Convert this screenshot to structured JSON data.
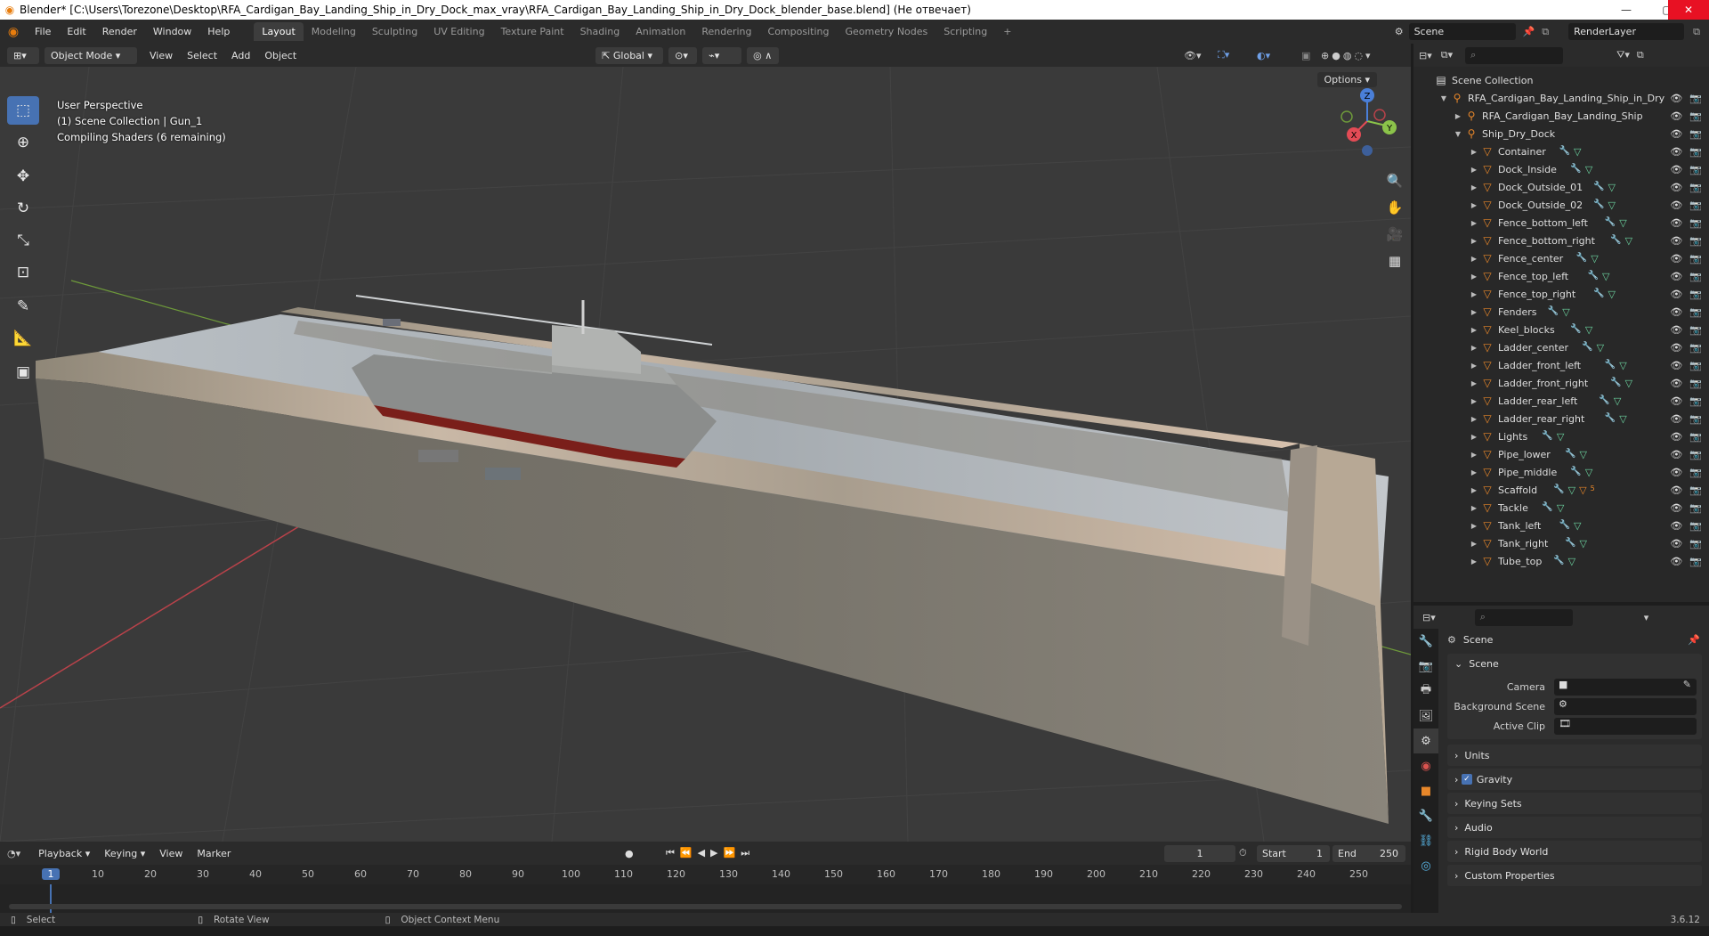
{
  "titlebar": {
    "title": "Blender* [C:\\Users\\Torezone\\Desktop\\RFA_Cardigan_Bay_Landing_Ship_in_Dry_Dock_max_vray\\RFA_Cardigan_Bay_Landing_Ship_in_Dry_Dock_blender_base.blend] (Не отвечает)",
    "minimize": "—",
    "maximize": "▢",
    "close": "✕"
  },
  "menus": [
    "File",
    "Edit",
    "Render",
    "Window",
    "Help"
  ],
  "workspaces": [
    "Layout",
    "Modeling",
    "Sculpting",
    "UV Editing",
    "Texture Paint",
    "Shading",
    "Animation",
    "Rendering",
    "Compositing",
    "Geometry Nodes",
    "Scripting"
  ],
  "add_workspace": "+",
  "scene_selector": {
    "value": "Scene"
  },
  "viewlayer_selector": {
    "value": "RenderLayer"
  },
  "viewport_header": {
    "mode": "Object Mode",
    "menus": [
      "View",
      "Select",
      "Add",
      "Object"
    ],
    "transform": "Global"
  },
  "viewport": {
    "options": "Options",
    "info": [
      "User Perspective",
      "(1) Scene Collection | Gun_1",
      "Compiling Shaders (6 remaining)"
    ],
    "gizmo_labels": {
      "x": "X",
      "y": "Y",
      "z": "Z"
    }
  },
  "outliner": {
    "root": "Scene Collection",
    "top_object": "RFA_Cardigan_Bay_Landing_Ship_in_Dry",
    "ship": "RFA_Cardigan_Bay_Landing_Ship",
    "dock": "Ship_Dry_Dock",
    "children": [
      "Container",
      "Dock_Inside",
      "Dock_Outside_01",
      "Dock_Outside_02",
      "Fence_bottom_left",
      "Fence_bottom_right",
      "Fence_center",
      "Fence_top_left",
      "Fence_top_right",
      "Fenders",
      "Keel_blocks",
      "Ladder_center",
      "Ladder_front_left",
      "Ladder_front_right",
      "Ladder_rear_left",
      "Ladder_rear_right",
      "Lights",
      "Pipe_lower",
      "Pipe_middle",
      "Scaffold",
      "Tackle",
      "Tank_left",
      "Tank_right",
      "Tube_top"
    ],
    "scaffold_badge": "5"
  },
  "properties": {
    "header": "Scene",
    "panel": "Scene",
    "fields": [
      {
        "label": "Camera"
      },
      {
        "label": "Background Scene"
      },
      {
        "label": "Active Clip"
      }
    ],
    "subpanels": [
      "Units",
      "Gravity",
      "Keying Sets",
      "Audio",
      "Rigid Body World",
      "Custom Properties"
    ]
  },
  "timeline": {
    "menus": [
      "Playback",
      "Keying",
      "View",
      "Marker"
    ],
    "current_frame": "1",
    "start_label": "Start",
    "start": "1",
    "end_label": "End",
    "end": "250",
    "ruler": [
      "1",
      "10",
      "20",
      "30",
      "40",
      "50",
      "60",
      "70",
      "80",
      "90",
      "100",
      "110",
      "120",
      "130",
      "140",
      "150",
      "160",
      "170",
      "180",
      "190",
      "200",
      "210",
      "220",
      "230",
      "240",
      "250"
    ]
  },
  "statusbar": {
    "items": [
      "Select",
      "Rotate View",
      "Object Context Menu"
    ],
    "version": "3.6.12"
  },
  "colors": {
    "accent": "#4772b3",
    "object_orange": "#e8872a",
    "header": "#2b2b2b",
    "viewport": "#3a3a3a"
  }
}
